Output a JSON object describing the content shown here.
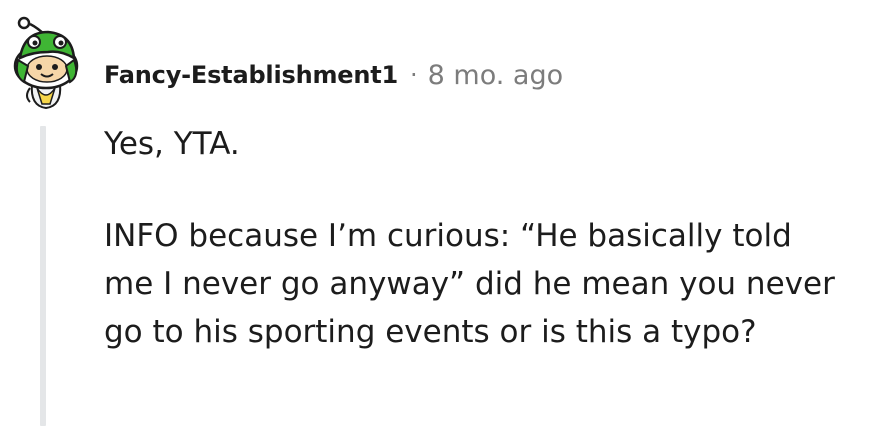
{
  "comment": {
    "author": "Fancy-Establishment1",
    "separator": "·",
    "timestamp": "8 mo. ago",
    "avatar_icon": "snoo-avatar-green-hat-icon",
    "paragraphs": [
      "Yes, YTA.",
      "INFO because I’m curious: “He basically told me I never go anyway” did he mean you never go to his sporting events or is this a typo?"
    ],
    "colors": {
      "text": "#1c1c1c",
      "meta": "#7c7c7c",
      "thread_line": "#e4e6e8",
      "avatar_green": "#3fb534"
    }
  }
}
